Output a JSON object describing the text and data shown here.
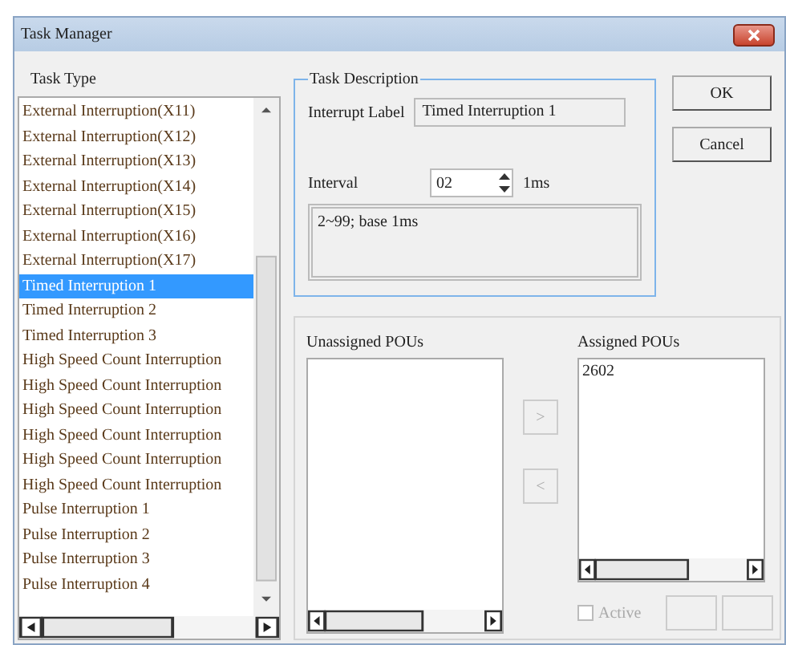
{
  "window": {
    "title": "Task Manager"
  },
  "task_type": {
    "label": "Task Type",
    "items": [
      {
        "label": "External Interruption(X11)",
        "selected": false
      },
      {
        "label": "External Interruption(X12)",
        "selected": false
      },
      {
        "label": "External Interruption(X13)",
        "selected": false
      },
      {
        "label": "External Interruption(X14)",
        "selected": false
      },
      {
        "label": "External Interruption(X15)",
        "selected": false
      },
      {
        "label": "External Interruption(X16)",
        "selected": false
      },
      {
        "label": "External Interruption(X17)",
        "selected": false
      },
      {
        "label": "Timed Interruption 1",
        "selected": true
      },
      {
        "label": "Timed Interruption 2",
        "selected": false
      },
      {
        "label": "Timed Interruption 3",
        "selected": false
      },
      {
        "label": "High Speed Count Interruption",
        "selected": false
      },
      {
        "label": "High Speed Count Interruption",
        "selected": false
      },
      {
        "label": "High Speed Count Interruption",
        "selected": false
      },
      {
        "label": "High Speed Count Interruption",
        "selected": false
      },
      {
        "label": "High Speed Count Interruption",
        "selected": false
      },
      {
        "label": "High Speed Count Interruption",
        "selected": false
      },
      {
        "label": "Pulse Interruption 1",
        "selected": false
      },
      {
        "label": "Pulse Interruption 2",
        "selected": false
      },
      {
        "label": "Pulse Interruption 3",
        "selected": false
      },
      {
        "label": "Pulse Interruption 4",
        "selected": false
      }
    ]
  },
  "task_description": {
    "title": "Task Description",
    "interrupt_label": {
      "label": "Interrupt Label",
      "value": "Timed Interruption 1"
    },
    "interval": {
      "label": "Interval",
      "value": "02",
      "unit": "1ms"
    },
    "hint": "2~99; base 1ms"
  },
  "buttons": [
    "OK",
    "Cancel"
  ],
  "unassigned": {
    "label": "Unassigned POUs"
  },
  "move_buttons": [
    ">",
    "<"
  ],
  "assigned": {
    "label": "Assigned POUs",
    "items": [
      "2602"
    ]
  },
  "active": {
    "label": "Active",
    "checked": false,
    "disabled": true
  }
}
